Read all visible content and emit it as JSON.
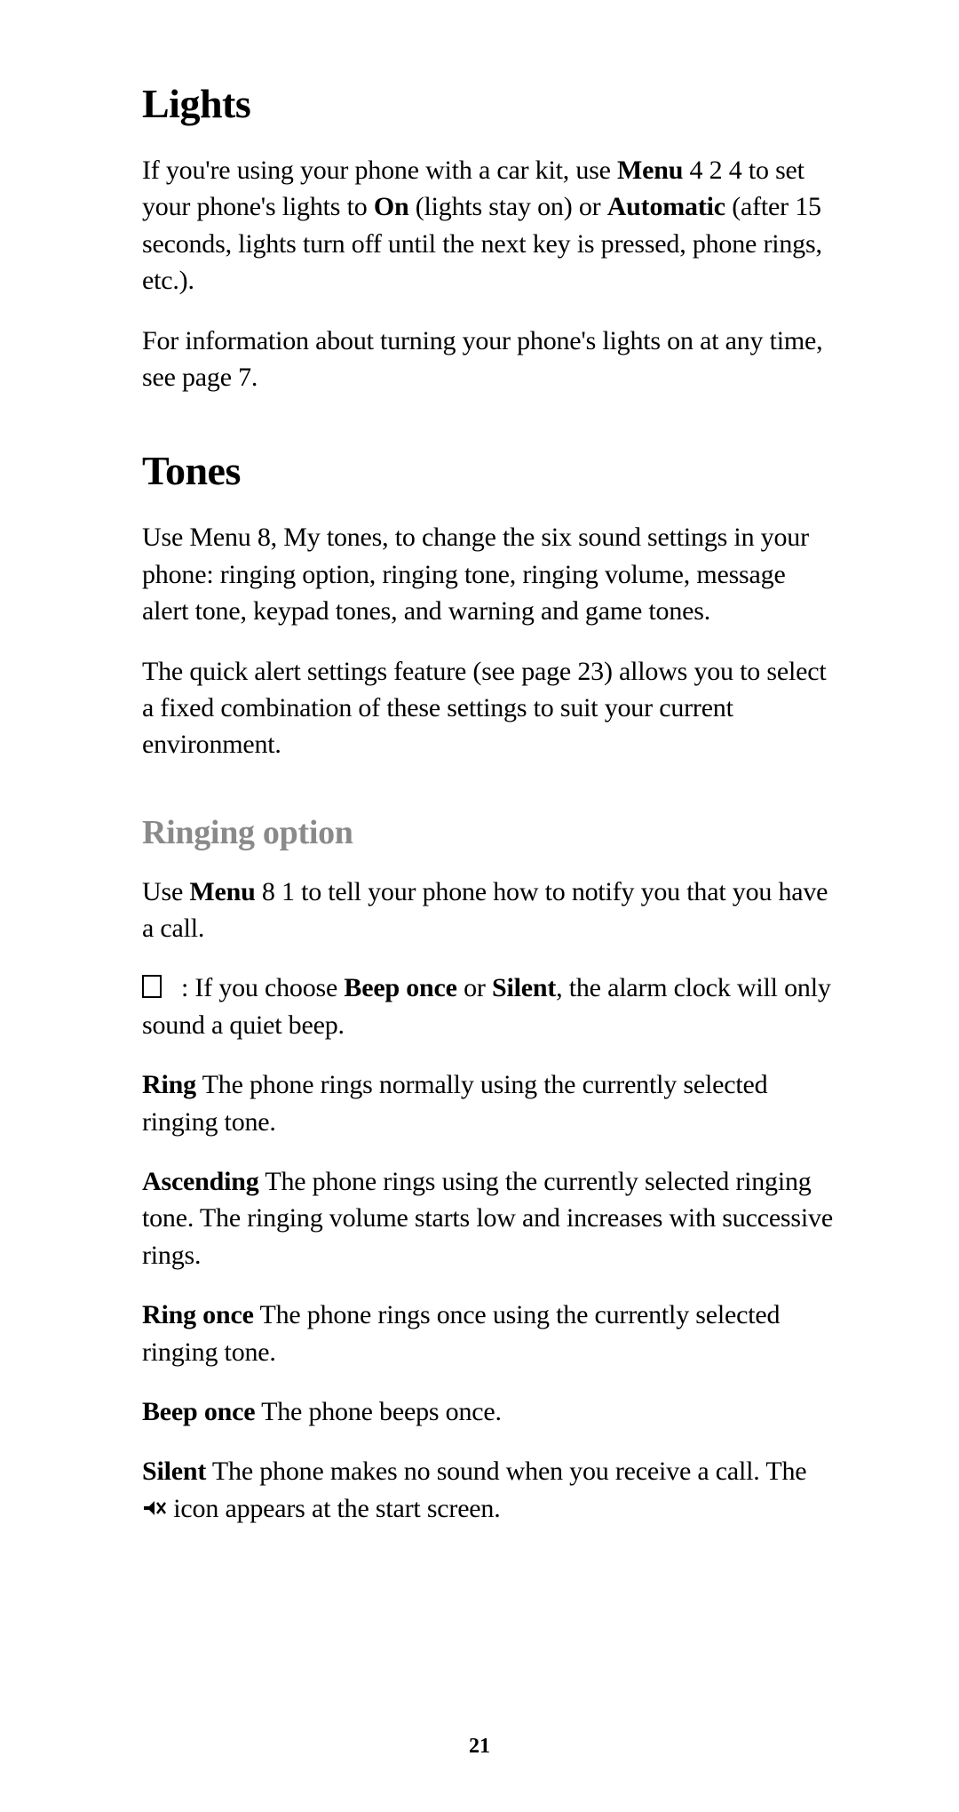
{
  "sections": {
    "lights": {
      "heading": "Lights",
      "p1_a": "If you're using your phone with a car kit, use ",
      "p1_b": "Menu",
      "p1_c": " 4 2 4 to set your phone's lights to ",
      "p1_d": "On",
      "p1_e": " (lights stay on) or ",
      "p1_f": "Automatic",
      "p1_g": " (after 15 seconds, lights turn off until the next key is pressed, phone rings, etc.).",
      "p2": "For information about turning your phone's lights on at any time, see page 7."
    },
    "tones": {
      "heading": "Tones",
      "p1": "Use Menu 8, My tones, to change the six sound settings in your phone: ringing option, ringing tone, ringing volume, message alert tone, keypad tones, and warning and game tones.",
      "p2": "The quick alert settings feature (see page 23) allows you to select a fixed combination of these settings to suit your current environment."
    },
    "ringing": {
      "heading": "Ringing option",
      "p1_a": "Use ",
      "p1_b": "Menu",
      "p1_c": " 8 1 to tell your phone how to notify you that you have a call.",
      "note_a": ":  If you choose ",
      "note_b": "Beep once",
      "note_c": " or ",
      "note_d": "Silent",
      "note_e": ", the alarm clock will only sound a quiet beep.",
      "ring_b": "Ring",
      "ring_t": "  The phone rings normally using the currently selected ringing tone.",
      "asc_b": "Ascending",
      "asc_t": "  The phone rings using the currently selected ringing tone. The ringing volume starts low and increases with successive rings.",
      "ronce_b": "Ring once",
      "ronce_t": "  The phone rings once using the currently selected ringing tone.",
      "bonce_b": "Beep once",
      "bonce_t": "  The phone beeps once.",
      "sil_b": "Silent",
      "sil_t1": "  The phone makes no sound when you receive a call. The  ",
      "sil_t2": "  icon appears at the start screen."
    }
  },
  "page_number": "21"
}
